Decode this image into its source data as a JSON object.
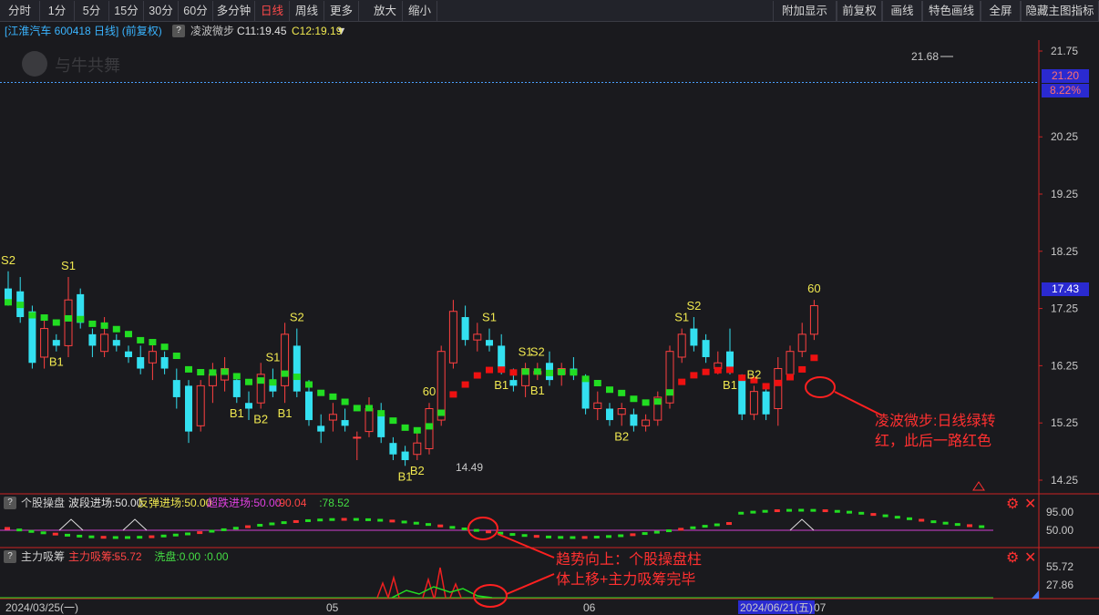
{
  "toolbar": {
    "left": [
      "分时",
      "1分",
      "5分",
      "15分",
      "30分",
      "60分",
      "多分钟",
      "日线",
      "周线",
      "更多▼",
      "放大",
      "缩小"
    ],
    "active_index": 7,
    "right": [
      "附加显示",
      "前复权",
      "画线",
      "特色画线",
      "全屏",
      "隐藏主图指标"
    ]
  },
  "header": {
    "stock": "[江淮汽车 600418 日线] (前复权)",
    "help": "?",
    "indicator": "凌波微步",
    "c1": "C11:19.45",
    "c2": "C12:19.19"
  },
  "watermark": "与牛共舞",
  "price_axis": {
    "ticks": [
      "21.75",
      "20.25",
      "19.25",
      "18.25",
      "17.25",
      "16.25",
      "15.25",
      "14.25"
    ],
    "current_price": "21.20",
    "current_pct": "8.22%",
    "cursor_price": "17.43"
  },
  "annotations_main": {
    "high": "21.68",
    "low": "14.49",
    "wave_note": "凌波微步:日线绿转\n红，此后一路红色",
    "trend_note": "趋势向上：个股操盘柱\n体上移+主力吸筹完毕"
  },
  "signals": [
    {
      "text": "S2",
      "i": 0,
      "pos": "above"
    },
    {
      "text": "S1",
      "i": 5,
      "pos": "above"
    },
    {
      "text": "B1",
      "i": 4,
      "pos": "below"
    },
    {
      "text": "S1",
      "i": 22,
      "pos": "above"
    },
    {
      "text": "S2",
      "i": 24,
      "pos": "above"
    },
    {
      "text": "B1",
      "i": 19,
      "pos": "below"
    },
    {
      "text": "B2",
      "i": 21,
      "pos": "below"
    },
    {
      "text": "B1",
      "i": 23,
      "pos": "below"
    },
    {
      "text": "60",
      "i": 35,
      "pos": "above"
    },
    {
      "text": "B1",
      "i": 33,
      "pos": "below"
    },
    {
      "text": "B2",
      "i": 34,
      "pos": "below"
    },
    {
      "text": "S1",
      "i": 40,
      "pos": "above"
    },
    {
      "text": "S1",
      "i": 43,
      "pos": "above"
    },
    {
      "text": "S2",
      "i": 44,
      "pos": "above"
    },
    {
      "text": "B1",
      "i": 41,
      "pos": "below"
    },
    {
      "text": "B1",
      "i": 44,
      "pos": "below"
    },
    {
      "text": "S1",
      "i": 56,
      "pos": "above"
    },
    {
      "text": "S2",
      "i": 57,
      "pos": "above"
    },
    {
      "text": "B2",
      "i": 51,
      "pos": "below"
    },
    {
      "text": "B1",
      "i": 60,
      "pos": "below"
    },
    {
      "text": "B2",
      "i": 62,
      "pos": "above"
    },
    {
      "text": "60",
      "i": 67,
      "pos": "above"
    },
    {
      "text": "60",
      "i": 71,
      "pos": "above"
    }
  ],
  "sub1": {
    "help": "?",
    "name": "个股操盘",
    "items": [
      {
        "label": "波段进场:50.00",
        "color": "#e0e0e0"
      },
      {
        "label": "反弹进场:50.00",
        "color": "#f0e850"
      },
      {
        "label": "超跌进场:50.00",
        "color": "#e040e0"
      },
      {
        "label": ":90.04",
        "color": "#ff4444"
      },
      {
        "label": ":78.52",
        "color": "#44dd44"
      }
    ],
    "ticks": [
      "95.00",
      "50.00"
    ]
  },
  "sub2": {
    "help": "?",
    "name": "主力吸筹",
    "items": [
      {
        "label": "主力吸筹:-",
        "color": "#ff4444"
      },
      {
        "label": ":55.72",
        "color": "#ff4444"
      },
      {
        "label": "洗盘:0.00",
        "color": "#44dd44"
      },
      {
        "label": ":0.00",
        "color": "#44dd44"
      }
    ],
    "ticks": [
      "55.72",
      "27.86"
    ]
  },
  "date_axis": {
    "labels": [
      "2024/03/25(一)",
      "05",
      "06",
      "2024/06/21(五)",
      "07"
    ]
  },
  "colors": {
    "up": "#ff4040",
    "down": "#33e0f0",
    "green": "#22dd22",
    "red": "#ee1111",
    "yellow": "#f0e850",
    "axis": "#cc2222",
    "note": "#ff3030"
  },
  "chart_data": {
    "type": "candlestick",
    "ylim": [
      14.25,
      21.75
    ],
    "ohlc": [
      [
        17.6,
        17.9,
        17.3,
        17.35
      ],
      [
        17.55,
        17.8,
        17.0,
        17.1
      ],
      [
        17.2,
        17.3,
        16.2,
        16.3
      ],
      [
        16.4,
        17.1,
        16.2,
        16.9
      ],
      [
        16.7,
        16.8,
        16.5,
        16.6
      ],
      [
        16.6,
        17.8,
        16.4,
        17.4
      ],
      [
        17.5,
        17.6,
        16.9,
        17.0
      ],
      [
        16.8,
        16.9,
        16.4,
        16.6
      ],
      [
        16.5,
        17.1,
        16.4,
        16.8
      ],
      [
        16.7,
        16.8,
        16.5,
        16.6
      ],
      [
        16.5,
        16.6,
        16.3,
        16.4
      ],
      [
        16.4,
        16.6,
        16.1,
        16.2
      ],
      [
        16.3,
        16.7,
        16.0,
        16.5
      ],
      [
        16.4,
        16.5,
        16.1,
        16.2
      ],
      [
        16.0,
        16.2,
        15.5,
        15.7
      ],
      [
        15.9,
        16.0,
        14.9,
        15.1
      ],
      [
        15.2,
        16.0,
        15.1,
        15.9
      ],
      [
        15.9,
        16.3,
        15.6,
        16.1
      ],
      [
        16.0,
        16.4,
        15.8,
        16.2
      ],
      [
        16.0,
        16.1,
        15.6,
        15.7
      ],
      [
        15.6,
        15.8,
        15.3,
        15.5
      ],
      [
        15.6,
        16.3,
        15.5,
        16.1
      ],
      [
        16.0,
        16.2,
        15.7,
        15.8
      ],
      [
        15.9,
        17.0,
        15.6,
        16.8
      ],
      [
        16.6,
        16.9,
        15.7,
        15.8
      ],
      [
        15.8,
        16.0,
        15.2,
        15.3
      ],
      [
        15.2,
        15.4,
        14.9,
        15.1
      ],
      [
        15.3,
        15.6,
        15.1,
        15.4
      ],
      [
        15.3,
        15.5,
        15.1,
        15.2
      ],
      [
        15.0,
        15.1,
        14.6,
        15.0
      ],
      [
        15.1,
        15.7,
        15.0,
        15.5
      ],
      [
        15.4,
        15.6,
        14.9,
        15.0
      ],
      [
        14.9,
        15.0,
        14.6,
        14.7
      ],
      [
        14.75,
        14.85,
        14.5,
        14.6
      ],
      [
        14.7,
        15.1,
        14.6,
        14.9
      ],
      [
        14.8,
        15.6,
        14.7,
        15.5
      ],
      [
        15.3,
        16.6,
        15.2,
        16.5
      ],
      [
        16.3,
        17.4,
        16.2,
        17.2
      ],
      [
        17.1,
        17.3,
        16.6,
        16.7
      ],
      [
        16.7,
        17.0,
        16.5,
        16.8
      ],
      [
        16.7,
        16.9,
        16.5,
        16.6
      ],
      [
        16.6,
        16.8,
        16.1,
        16.2
      ],
      [
        16.0,
        16.2,
        15.8,
        15.9
      ],
      [
        15.9,
        16.3,
        15.7,
        16.2
      ],
      [
        16.1,
        16.3,
        16.0,
        16.15
      ],
      [
        16.3,
        16.5,
        15.9,
        16.0
      ],
      [
        16.1,
        16.3,
        15.9,
        16.2
      ],
      [
        16.2,
        16.4,
        16.0,
        16.1
      ],
      [
        16.0,
        16.1,
        15.4,
        15.5
      ],
      [
        15.5,
        15.8,
        15.3,
        15.6
      ],
      [
        15.5,
        15.6,
        15.2,
        15.3
      ],
      [
        15.4,
        15.6,
        15.2,
        15.5
      ],
      [
        15.4,
        15.5,
        15.1,
        15.2
      ],
      [
        15.2,
        15.4,
        15.1,
        15.3
      ],
      [
        15.3,
        15.8,
        15.2,
        15.7
      ],
      [
        15.6,
        16.6,
        15.5,
        16.5
      ],
      [
        16.4,
        16.9,
        16.3,
        16.8
      ],
      [
        16.9,
        17.1,
        16.5,
        16.6
      ],
      [
        16.7,
        16.8,
        16.3,
        16.4
      ],
      [
        16.2,
        16.5,
        16.1,
        16.3
      ],
      [
        16.5,
        16.9,
        16.1,
        16.2
      ],
      [
        16.0,
        16.1,
        15.3,
        15.4
      ],
      [
        15.4,
        15.9,
        15.3,
        15.8
      ],
      [
        15.8,
        15.9,
        15.3,
        15.4
      ],
      [
        15.5,
        16.4,
        15.2,
        16.2
      ],
      [
        16.1,
        16.6,
        16.0,
        16.5
      ],
      [
        16.5,
        17.0,
        16.4,
        16.8
      ],
      [
        16.8,
        17.4,
        16.7,
        17.3
      ]
    ]
  }
}
